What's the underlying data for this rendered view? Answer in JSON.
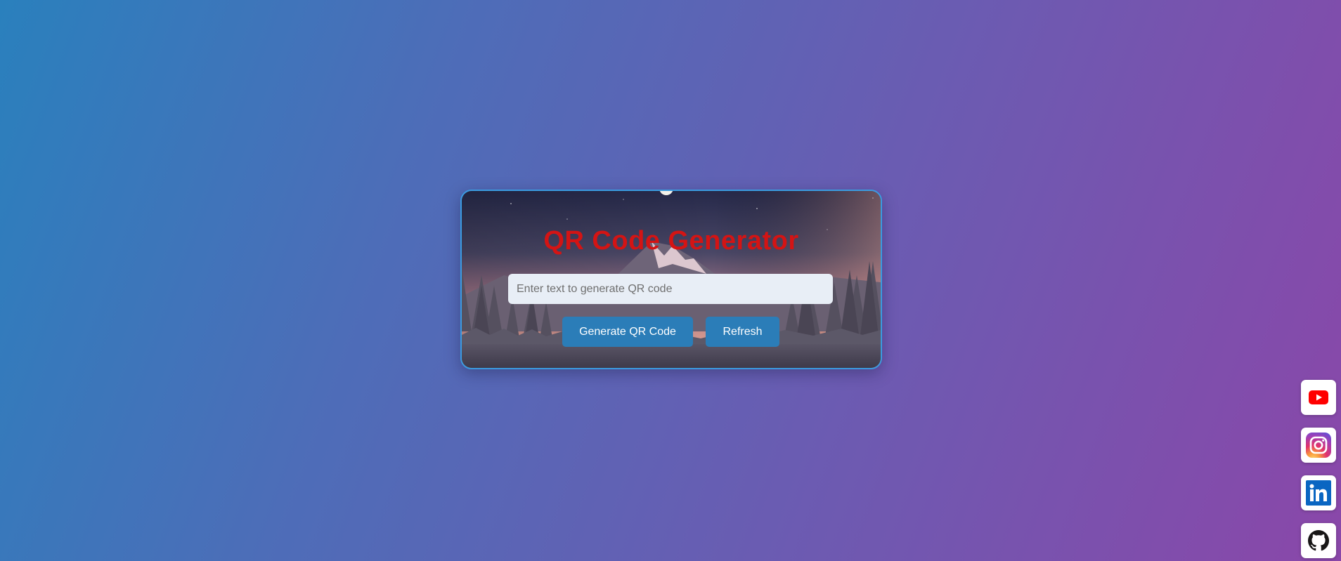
{
  "card": {
    "title": "QR Code Generator",
    "input_placeholder": "Enter text to generate QR code",
    "input_value": "",
    "generate_label": "Generate QR Code",
    "refresh_label": "Refresh"
  },
  "social_links": [
    {
      "name": "youtube-icon",
      "color": "#ff0000"
    },
    {
      "name": "instagram-icon",
      "color": "#d62976"
    },
    {
      "name": "linkedin-icon",
      "color": "#0a66c2"
    },
    {
      "name": "github-icon",
      "color": "#181717"
    }
  ],
  "colors": {
    "title": "#d41414",
    "button": "#2b7db8",
    "card_border": "#3b9be0"
  }
}
